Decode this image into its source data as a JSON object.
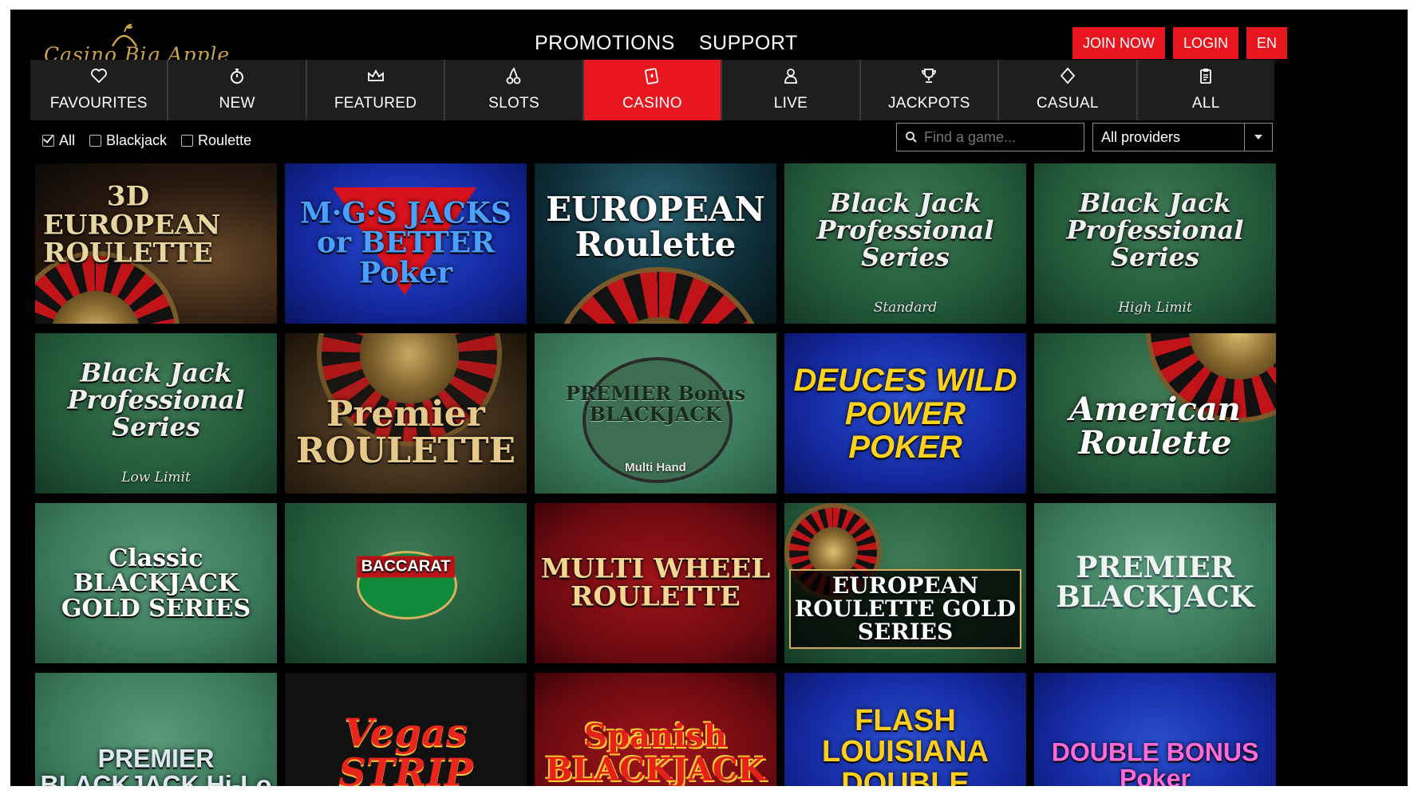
{
  "header": {
    "logo_text": "Casino Big Apple",
    "nav": [
      "PROMOTIONS",
      "SUPPORT"
    ],
    "join_label": "JOIN NOW",
    "login_label": "LOGIN",
    "lang_label": "EN",
    "accent_color": "#e8171f"
  },
  "categories": [
    {
      "label": "FAVOURITES",
      "icon": "heart-icon"
    },
    {
      "label": "NEW",
      "icon": "stopwatch-icon"
    },
    {
      "label": "FEATURED",
      "icon": "crown-icon"
    },
    {
      "label": "SLOTS",
      "icon": "cherries-icon"
    },
    {
      "label": "CASINO",
      "icon": "cards-icon",
      "active": true
    },
    {
      "label": "LIVE",
      "icon": "dealer-icon"
    },
    {
      "label": "JACKPOTS",
      "icon": "trophy-icon"
    },
    {
      "label": "CASUAL",
      "icon": "diamond-icon"
    },
    {
      "label": "ALL",
      "icon": "clipboard-icon"
    }
  ],
  "filters": {
    "options": [
      {
        "label": "All",
        "checked": true
      },
      {
        "label": "Blackjack",
        "checked": false
      },
      {
        "label": "Roulette",
        "checked": false
      }
    ],
    "search_placeholder": "Find a game...",
    "provider_value": "All providers"
  },
  "games": [
    {
      "title": "3D EUROPEAN ROULETTE",
      "sub": ""
    },
    {
      "title": "M·G·S JACKS or BETTER Poker",
      "sub": ""
    },
    {
      "title": "EUROPEAN Roulette",
      "sub": ""
    },
    {
      "title": "Black Jack Professional Series",
      "sub": "Standard"
    },
    {
      "title": "Black Jack Professional Series",
      "sub": "High Limit"
    },
    {
      "title": "Black Jack Professional Series",
      "sub": "Low Limit"
    },
    {
      "title": "Premier ROULETTE",
      "sub": ""
    },
    {
      "title": "PREMIER Bonus BLACKJACK",
      "sub": "Multi Hand"
    },
    {
      "title": "DEUCES WILD POWER POKER",
      "sub": ""
    },
    {
      "title": "American Roulette",
      "sub": ""
    },
    {
      "title": "Classic BLACKJACK GOLD SERIES",
      "sub": ""
    },
    {
      "title": "BACCARAT",
      "sub": ""
    },
    {
      "title": "MULTI WHEEL ROULETTE",
      "sub": ""
    },
    {
      "title": "EUROPEAN ROULETTE GOLD SERIES",
      "sub": ""
    },
    {
      "title": "PREMIER BLACKJACK",
      "sub": ""
    },
    {
      "title": "PREMIER BLACKJACK Hi-Lo",
      "sub": ""
    },
    {
      "title": "Vegas STRIP",
      "sub": ""
    },
    {
      "title": "Spanish BLACKJACK",
      "sub": ""
    },
    {
      "title": "FLASH LOUISIANA DOUBLE",
      "sub": ""
    },
    {
      "title": "DOUBLE BONUS Poker",
      "sub": ""
    }
  ]
}
